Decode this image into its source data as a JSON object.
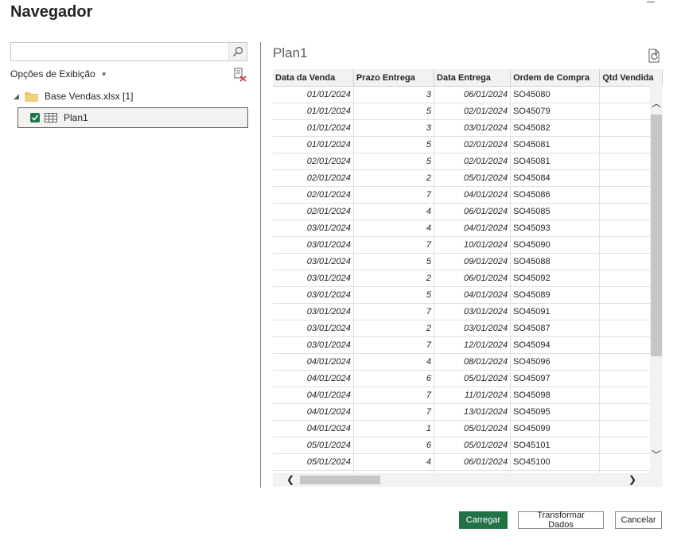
{
  "window": {
    "title": "Navegador"
  },
  "left": {
    "search_placeholder": "",
    "options_label": "Opções de Exibição",
    "tree": {
      "root_label": "Base Vendas.xlsx [1]",
      "items": [
        {
          "label": "Plan1",
          "checked": true
        }
      ]
    }
  },
  "preview": {
    "title": "Plan1",
    "columns": [
      "Data da Venda",
      "Prazo Entrega",
      "Data Entrega",
      "Ordem de Compra",
      "Qtd Vendida"
    ],
    "rows": [
      [
        "01/01/2024",
        "3",
        "06/01/2024",
        "SO45080",
        ""
      ],
      [
        "01/01/2024",
        "5",
        "02/01/2024",
        "SO45079",
        ""
      ],
      [
        "01/01/2024",
        "3",
        "03/01/2024",
        "SO45082",
        ""
      ],
      [
        "01/01/2024",
        "5",
        "02/01/2024",
        "SO45081",
        ""
      ],
      [
        "02/01/2024",
        "5",
        "02/01/2024",
        "SO45081",
        ""
      ],
      [
        "02/01/2024",
        "2",
        "05/01/2024",
        "SO45084",
        ""
      ],
      [
        "02/01/2024",
        "7",
        "04/01/2024",
        "SO45086",
        ""
      ],
      [
        "02/01/2024",
        "4",
        "06/01/2024",
        "SO45085",
        ""
      ],
      [
        "03/01/2024",
        "4",
        "04/01/2024",
        "SO45093",
        ""
      ],
      [
        "03/01/2024",
        "7",
        "10/01/2024",
        "SO45090",
        ""
      ],
      [
        "03/01/2024",
        "5",
        "09/01/2024",
        "SO45088",
        ""
      ],
      [
        "03/01/2024",
        "2",
        "06/01/2024",
        "SO45092",
        ""
      ],
      [
        "03/01/2024",
        "5",
        "04/01/2024",
        "SO45089",
        ""
      ],
      [
        "03/01/2024",
        "7",
        "03/01/2024",
        "SO45091",
        ""
      ],
      [
        "03/01/2024",
        "2",
        "03/01/2024",
        "SO45087",
        ""
      ],
      [
        "03/01/2024",
        "7",
        "12/01/2024",
        "SO45094",
        ""
      ],
      [
        "04/01/2024",
        "4",
        "08/01/2024",
        "SO45096",
        ""
      ],
      [
        "04/01/2024",
        "6",
        "05/01/2024",
        "SO45097",
        ""
      ],
      [
        "04/01/2024",
        "7",
        "11/01/2024",
        "SO45098",
        ""
      ],
      [
        "04/01/2024",
        "7",
        "13/01/2024",
        "SO45095",
        ""
      ],
      [
        "04/01/2024",
        "1",
        "05/01/2024",
        "SO45099",
        ""
      ],
      [
        "05/01/2024",
        "6",
        "05/01/2024",
        "SO45101",
        ""
      ],
      [
        "05/01/2024",
        "4",
        "06/01/2024",
        "SO45100",
        ""
      ],
      [
        "",
        "",
        "",
        "",
        ""
      ]
    ]
  },
  "buttons": {
    "load": "Carregar",
    "transform": "Transformar Dados",
    "cancel": "Cancelar"
  },
  "colors": {
    "accent": "#217346",
    "header_bg": "#f3f2f1",
    "border": "#8a8886"
  },
  "icons": {
    "search": "search-icon",
    "clear": "clear-selection-icon",
    "refresh": "refresh-preview-icon",
    "folder": "folder-icon",
    "table": "table-icon"
  }
}
